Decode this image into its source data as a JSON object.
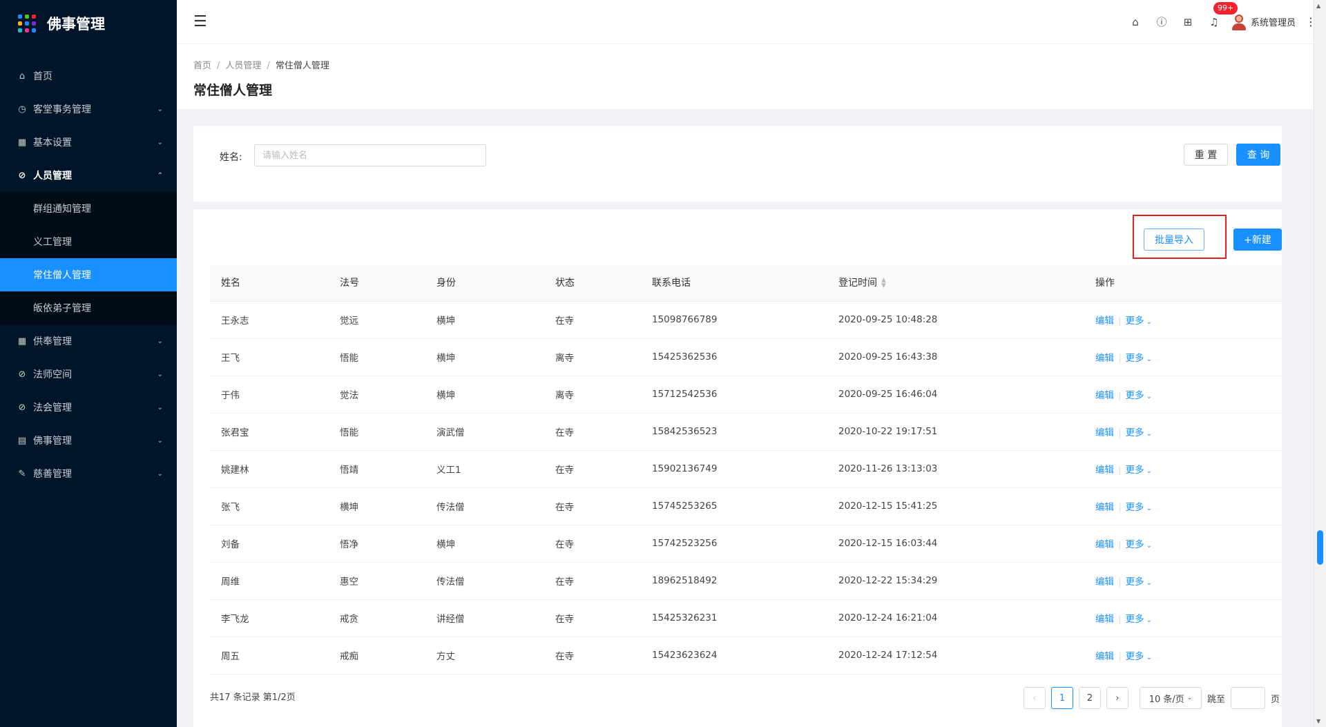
{
  "app": {
    "title": "佛事管理"
  },
  "logo_colors": [
    "#1890ff",
    "#52c41a",
    "#f5222d",
    "#faad14",
    "#1890ff",
    "#722ed1",
    "#13c2c2",
    "#eb2f96",
    "#1890ff"
  ],
  "sidebar": {
    "items": [
      {
        "label": "首页",
        "icon": "home-icon",
        "glyph": "⌂",
        "arrow": ""
      },
      {
        "label": "客堂事务管理",
        "icon": "dashboard-icon",
        "glyph": "◷",
        "arrow": "⌄"
      },
      {
        "label": "基本设置",
        "icon": "table-icon",
        "glyph": "▦",
        "arrow": "⌄"
      },
      {
        "label": "人员管理",
        "icon": "check-circle-icon",
        "glyph": "⊘",
        "arrow": "⌃"
      }
    ],
    "submenu": [
      {
        "label": "群组通知管理"
      },
      {
        "label": "义工管理"
      },
      {
        "label": "常住僧人管理"
      },
      {
        "label": "皈依弟子管理"
      }
    ],
    "items_after": [
      {
        "label": "供奉管理",
        "icon": "table-icon",
        "glyph": "▦",
        "arrow": "⌄"
      },
      {
        "label": "法师空间",
        "icon": "check-circle-icon",
        "glyph": "⊘",
        "arrow": "⌄"
      },
      {
        "label": "法会管理",
        "icon": "check-circle-icon",
        "glyph": "⊘",
        "arrow": "⌄"
      },
      {
        "label": "佛事管理",
        "icon": "file-icon",
        "glyph": "▤",
        "arrow": "⌄"
      },
      {
        "label": "慈善管理",
        "icon": "edit-icon",
        "glyph": "✎",
        "arrow": "⌄"
      }
    ]
  },
  "header": {
    "badge": "99+",
    "user_name": "系统管理员"
  },
  "breadcrumb": [
    "首页",
    "人员管理",
    "常住僧人管理"
  ],
  "page_title": "常住僧人管理",
  "search": {
    "label": "姓名:",
    "placeholder": "请输入姓名",
    "value": "",
    "reset": "重 置",
    "query": "查 询"
  },
  "toolbar": {
    "import": "批量导入",
    "create": "+新建"
  },
  "table": {
    "columns": [
      "姓名",
      "法号",
      "身份",
      "状态",
      "联系电话",
      "登记时间",
      "操作"
    ],
    "edit_label": "编辑",
    "more_label": "更多",
    "rows": [
      [
        "王永志",
        "觉远",
        "横坤",
        "在寺",
        "15098766789",
        "2020-09-25 10:48:28"
      ],
      [
        "王飞",
        "悟能",
        "横坤",
        "离寺",
        "15425362536",
        "2020-09-25 16:43:38"
      ],
      [
        "于伟",
        "觉法",
        "横坤",
        "离寺",
        "15712542536",
        "2020-09-25 16:46:04"
      ],
      [
        "张君宝",
        "悟能",
        "演武僧",
        "在寺",
        "15842536523",
        "2020-10-22 19:17:51"
      ],
      [
        "姚建林",
        "悟靖",
        "义工1",
        "在寺",
        "15902136749",
        "2020-11-26 13:13:03"
      ],
      [
        "张飞",
        "横坤",
        "传法僧",
        "在寺",
        "15745253265",
        "2020-12-15 15:41:25"
      ],
      [
        "刘备",
        "悟净",
        "横坤",
        "在寺",
        "15742523256",
        "2020-12-15 16:03:44"
      ],
      [
        "周维",
        "惠空",
        "传法僧",
        "在寺",
        "18962518492",
        "2020-12-22 15:34:29"
      ],
      [
        "李飞龙",
        "戒贪",
        "讲经僧",
        "在寺",
        "15425326231",
        "2020-12-24 16:21:04"
      ],
      [
        "周五",
        "戒痴",
        "方丈",
        "在寺",
        "15423623624",
        "2020-12-24 17:12:54"
      ]
    ]
  },
  "pagination": {
    "total_text": "共17 条记录 第1/2页",
    "pages": [
      "1",
      "2"
    ],
    "current": "1",
    "page_size": "10 条/页",
    "jump_label": "跳至",
    "page_unit": "页",
    "jump_value": ""
  }
}
